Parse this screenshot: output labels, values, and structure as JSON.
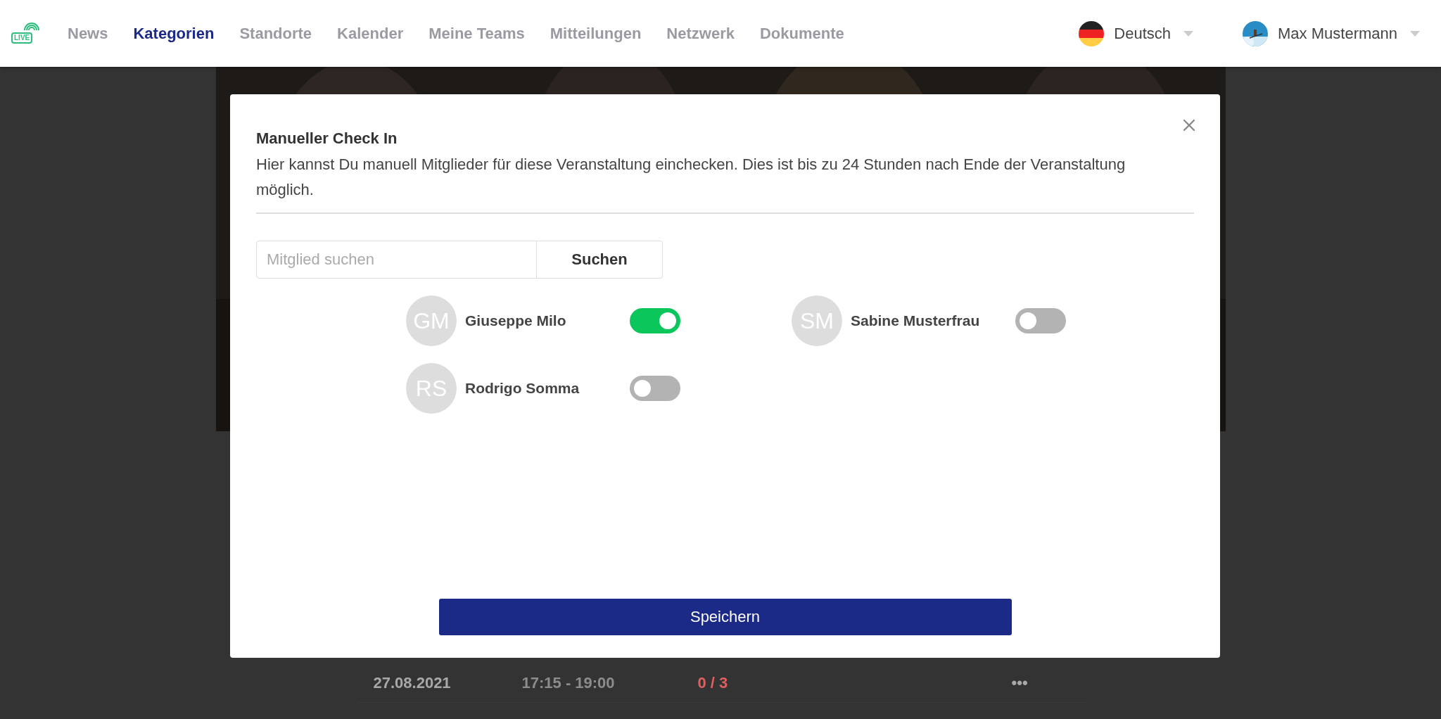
{
  "logo": {
    "text": "LIVE"
  },
  "nav": {
    "items": [
      {
        "label": "News",
        "selected": false
      },
      {
        "label": "Kategorien",
        "selected": true
      },
      {
        "label": "Standorte",
        "selected": false
      },
      {
        "label": "Kalender",
        "selected": false
      },
      {
        "label": "Meine Teams",
        "selected": false
      },
      {
        "label": "Mitteilungen",
        "selected": false
      },
      {
        "label": "Netzwerk",
        "selected": false
      },
      {
        "label": "Dokumente",
        "selected": false
      }
    ]
  },
  "language": {
    "label": "Deutsch"
  },
  "user": {
    "name": "Max Mustermann"
  },
  "background": {
    "rows": [
      {
        "date": "27.08.2021",
        "time": "17:15 - 19:00",
        "count": "0 / 3",
        "menu": "•••"
      }
    ]
  },
  "modal": {
    "title": "Manueller Check In",
    "description": "Hier kannst Du manuell Mitglieder für diese Veranstaltung einchecken. Dies ist bis zu 24 Stunden nach Ende der Veranstaltung möglich.",
    "search": {
      "placeholder": "Mitglied suchen",
      "button": "Suchen"
    },
    "members": [
      {
        "initials": "GM",
        "name": "Giuseppe Milo",
        "checked": true
      },
      {
        "initials": "SM",
        "name": "Sabine Musterfrau",
        "checked": false
      },
      {
        "initials": "RS",
        "name": "Rodrigo Somma",
        "checked": false
      }
    ],
    "save": "Speichern"
  }
}
